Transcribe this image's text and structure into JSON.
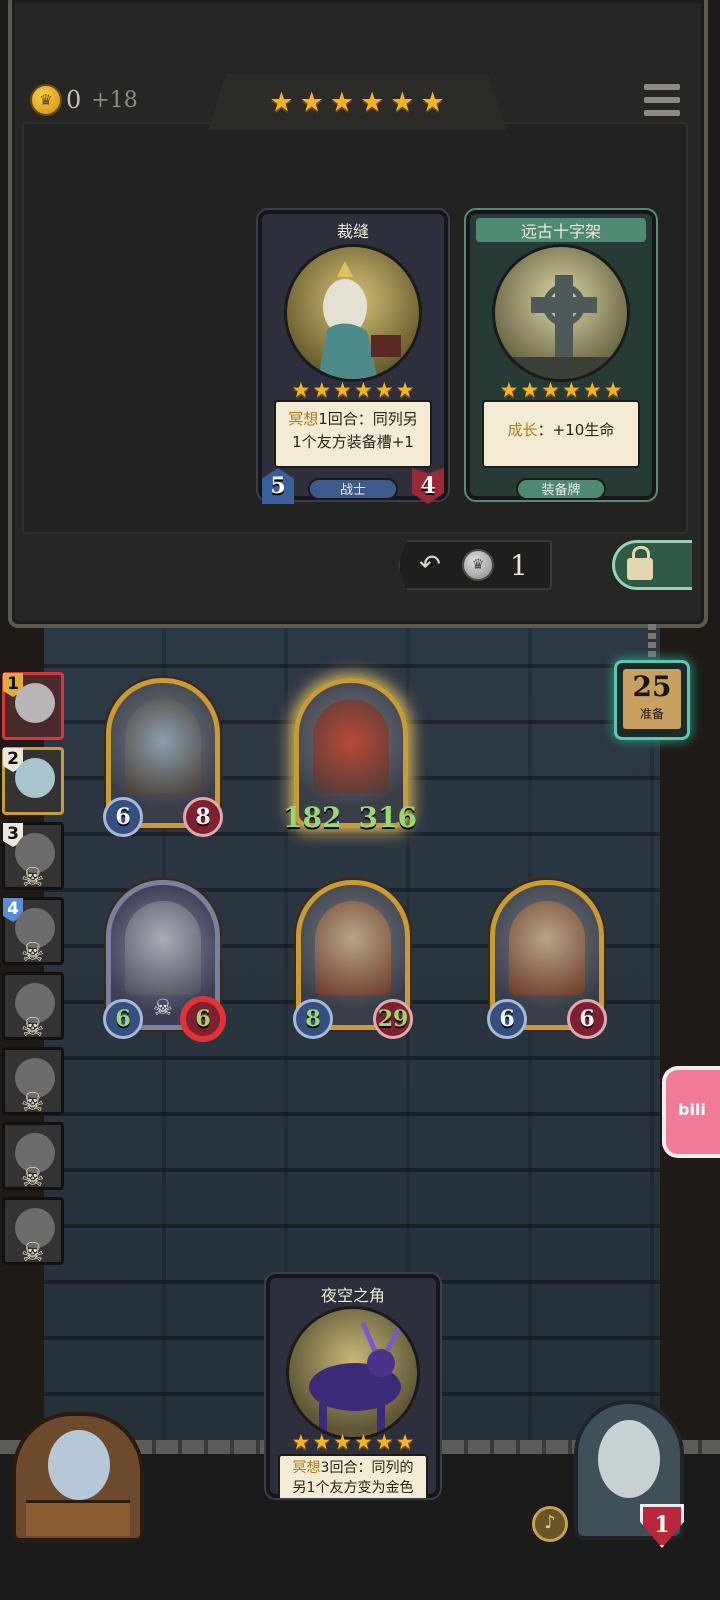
{
  "hud": {
    "gold": "0",
    "gold_income": "+18",
    "tier_stars": 6
  },
  "shop": {
    "cards": [
      {
        "title": "裁缝",
        "stars": 6,
        "desc_keyword": "冥想",
        "desc_line1": "1回合：同列另",
        "desc_line2": "1个友方装备槽+1",
        "type": "战士",
        "attack": "5",
        "health": "4"
      },
      {
        "title": "远古十字架",
        "stars": 6,
        "desc_keyword": "成长",
        "desc_rest": "：+10生命",
        "type": "装备牌"
      }
    ],
    "refresh_cost": "1"
  },
  "turn": {
    "number": "25",
    "label": "准备"
  },
  "team_slots": [
    {
      "num": "1",
      "state": "active"
    },
    {
      "num": "2",
      "state": "alive"
    },
    {
      "num": "3",
      "state": "dead"
    },
    {
      "num": "4",
      "state": "dead"
    },
    {
      "num": "",
      "state": "dead"
    },
    {
      "num": "",
      "state": "dead"
    },
    {
      "num": "",
      "state": "dead"
    },
    {
      "num": "",
      "state": "dead"
    }
  ],
  "board_units": [
    {
      "attack": "6",
      "health": "8"
    },
    {
      "attack": "182",
      "health": "316"
    },
    {
      "attack": "6",
      "health": "6"
    },
    {
      "attack": "8",
      "health": "29"
    },
    {
      "attack": "6",
      "health": "6"
    }
  ],
  "hand_card": {
    "title": "夜空之角",
    "stars": 6,
    "desc_keyword": "冥想",
    "desc_line1": "3回合：同列的",
    "desc_line2": "另1个友方变为金色"
  },
  "side_tab": "bili",
  "hero_health": "1",
  "colors": {
    "gold_star": "#f2b32a",
    "stat_attack": "#35507e",
    "stat_health": "#7e2030",
    "buffed_stat": "#9ad872",
    "turn_glow": "#5ac8b0"
  }
}
